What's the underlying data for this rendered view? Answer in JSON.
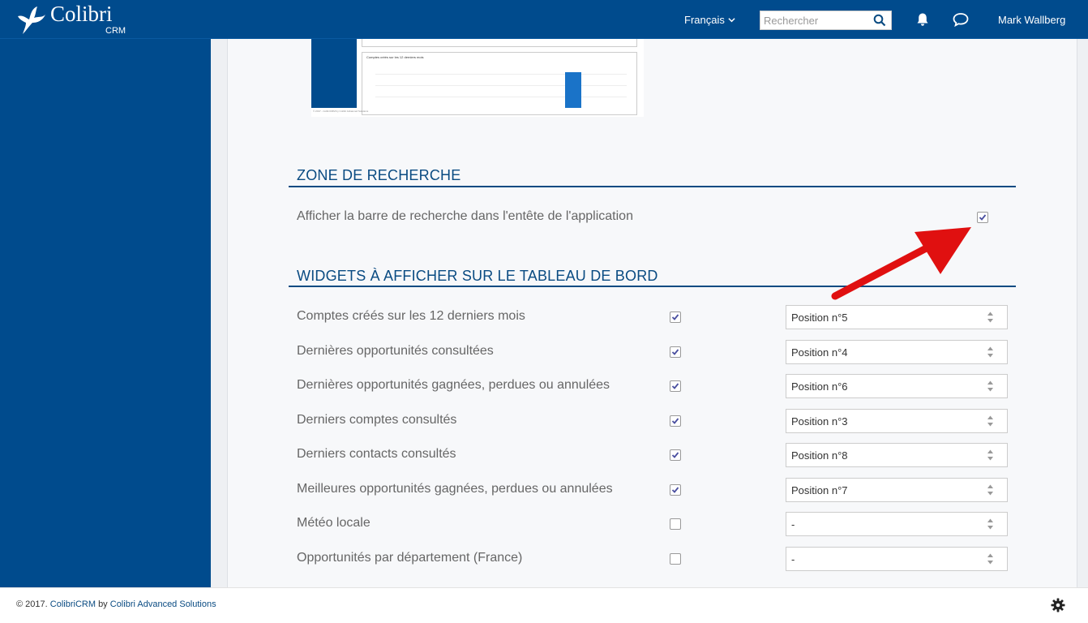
{
  "header": {
    "app_name": "Colibri",
    "app_sub": "CRM",
    "language": "Français",
    "search_placeholder": "Rechercher",
    "user_name": "Mark Wallberg"
  },
  "preview": {
    "chart_title": "Comptes créés sur les 12 derniers mois",
    "footer_note": "© 2017 - ColibriCRM by Colibri Advanced Solutions"
  },
  "search_section": {
    "title": "ZONE DE RECHERCHE",
    "option_label": "Afficher la barre de recherche dans l'entête de l'application",
    "option_checked": true
  },
  "widgets_section": {
    "title": "WIDGETS À AFFICHER SUR LE TABLEAU DE BORD",
    "widgets": [
      {
        "label": "Comptes créés sur les 12 derniers mois",
        "checked": true,
        "position": "Position n°5"
      },
      {
        "label": "Dernières opportunités consultées",
        "checked": true,
        "position": "Position n°4"
      },
      {
        "label": "Dernières opportunités gagnées, perdues ou annulées",
        "checked": true,
        "position": "Position n°6"
      },
      {
        "label": "Derniers comptes consultés",
        "checked": true,
        "position": "Position n°3"
      },
      {
        "label": "Derniers contacts consultés",
        "checked": true,
        "position": "Position n°8"
      },
      {
        "label": "Meilleures opportunités gagnées, perdues ou annulées",
        "checked": true,
        "position": "Position n°7"
      },
      {
        "label": "Météo locale",
        "checked": false,
        "position": "-"
      },
      {
        "label": "Opportunités par département (France)",
        "checked": false,
        "position": "-"
      }
    ]
  },
  "footer": {
    "copyright": "© 2017.",
    "product_link": "ColibriCRM",
    "by": "by",
    "company_link": "Colibri Advanced Solutions"
  },
  "colors": {
    "brand": "#004b8d",
    "accent": "#0a4b82",
    "annotation_arrow": "#e01010"
  },
  "icons": [
    "hummingbird-logo-icon",
    "chevron-down-icon",
    "search-icon",
    "bell-icon",
    "chat-icon",
    "checkmark-icon",
    "select-arrows-icon",
    "gear-icon",
    "red-arrow-annotation"
  ]
}
